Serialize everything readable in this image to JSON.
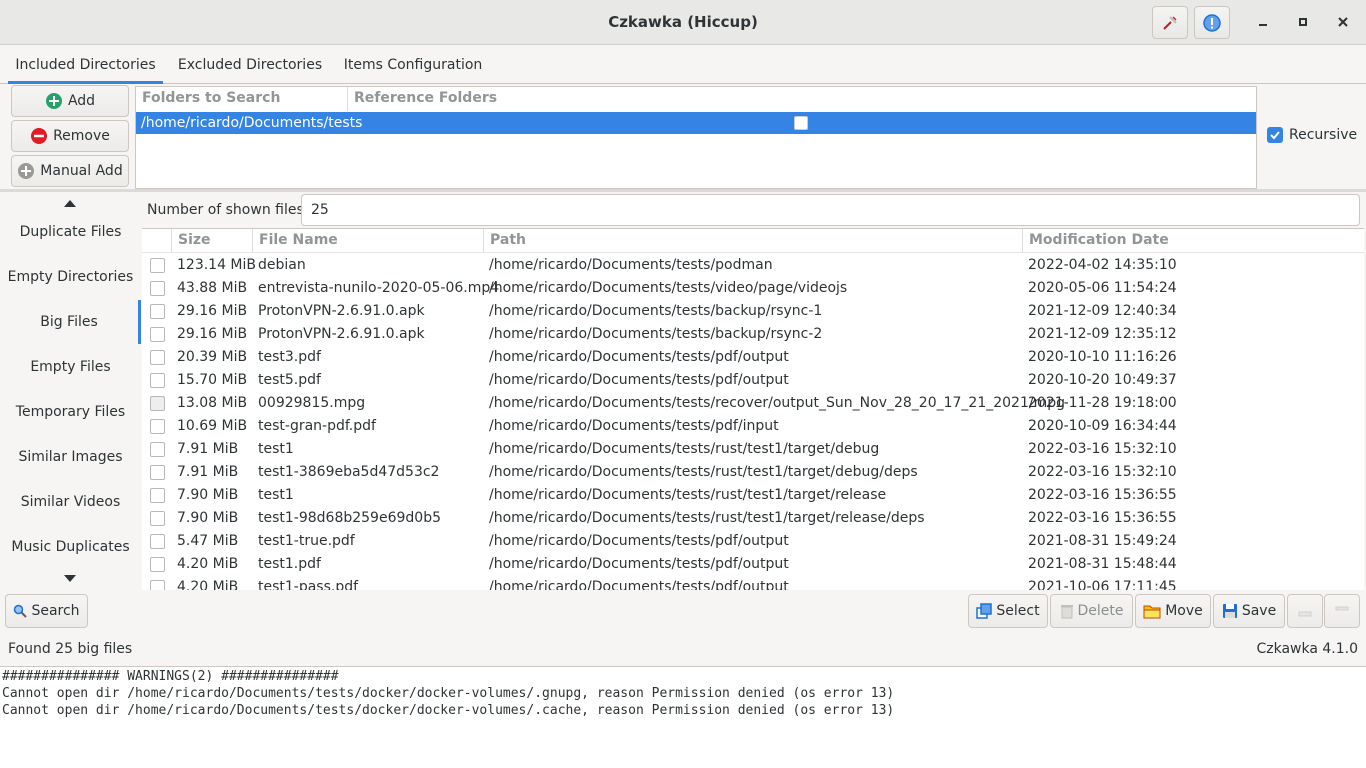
{
  "window": {
    "title": "Czkawka (Hiccup)"
  },
  "tabs": [
    "Included Directories",
    "Excluded Directories",
    "Items Configuration"
  ],
  "dir_buttons": {
    "add": "Add",
    "remove": "Remove",
    "manual_add": "Manual Add"
  },
  "dir_table": {
    "headers": [
      "Folders to Search",
      "Reference Folders"
    ],
    "rows": [
      {
        "path": "/home/ricardo/Documents/tests",
        "reference": false
      }
    ]
  },
  "recursive": {
    "label": "Recursive",
    "checked": true
  },
  "sidebar": {
    "items": [
      "Duplicate Files",
      "Empty Directories",
      "Big Files",
      "Empty Files",
      "Temporary Files",
      "Similar Images",
      "Similar Videos",
      "Music Duplicates"
    ],
    "active": "Big Files"
  },
  "shown_files": {
    "label": "Number of shown files",
    "value": "25"
  },
  "results": {
    "headers": [
      "Size",
      "File Name",
      "Path",
      "Modification Date"
    ],
    "rows": [
      {
        "size": "123.14 MiB",
        "name": "debian",
        "path": "/home/ricardo/Documents/tests/podman",
        "date": "2022-04-02 14:35:10"
      },
      {
        "size": "43.88 MiB",
        "name": "entrevista-nunilo-2020-05-06.mp4",
        "path": "/home/ricardo/Documents/tests/video/page/videojs",
        "date": "2020-05-06 11:54:24"
      },
      {
        "size": "29.16 MiB",
        "name": "ProtonVPN-2.6.91.0.apk",
        "path": "/home/ricardo/Documents/tests/backup/rsync-1",
        "date": "2021-12-09 12:40:34"
      },
      {
        "size": "29.16 MiB",
        "name": "ProtonVPN-2.6.91.0.apk",
        "path": "/home/ricardo/Documents/tests/backup/rsync-2",
        "date": "2021-12-09 12:35:12"
      },
      {
        "size": "20.39 MiB",
        "name": "test3.pdf",
        "path": "/home/ricardo/Documents/tests/pdf/output",
        "date": "2020-10-10 11:16:26"
      },
      {
        "size": "15.70 MiB",
        "name": "test5.pdf",
        "path": "/home/ricardo/Documents/tests/pdf/output",
        "date": "2020-10-20 10:49:37"
      },
      {
        "size": "13.08 MiB",
        "name": "00929815.mpg",
        "path": "/home/ricardo/Documents/tests/recover/output_Sun_Nov_28_20_17_21_2021/mpg",
        "date": "2021-11-28 19:18:00"
      },
      {
        "size": "10.69 MiB",
        "name": "test-gran-pdf.pdf",
        "path": "/home/ricardo/Documents/tests/pdf/input",
        "date": "2020-10-09 16:34:44"
      },
      {
        "size": "7.91 MiB",
        "name": "test1",
        "path": "/home/ricardo/Documents/tests/rust/test1/target/debug",
        "date": "2022-03-16 15:32:10"
      },
      {
        "size": "7.91 MiB",
        "name": "test1-3869eba5d47d53c2",
        "path": "/home/ricardo/Documents/tests/rust/test1/target/debug/deps",
        "date": "2022-03-16 15:32:10"
      },
      {
        "size": "7.90 MiB",
        "name": "test1",
        "path": "/home/ricardo/Documents/tests/rust/test1/target/release",
        "date": "2022-03-16 15:36:55"
      },
      {
        "size": "7.90 MiB",
        "name": "test1-98d68b259e69d0b5",
        "path": "/home/ricardo/Documents/tests/rust/test1/target/release/deps",
        "date": "2022-03-16 15:36:55"
      },
      {
        "size": "5.47 MiB",
        "name": "test1-true.pdf",
        "path": "/home/ricardo/Documents/tests/pdf/output",
        "date": "2021-08-31 15:49:24"
      },
      {
        "size": "4.20 MiB",
        "name": "test1.pdf",
        "path": "/home/ricardo/Documents/tests/pdf/output",
        "date": "2021-08-31 15:48:44"
      },
      {
        "size": "4.20 MiB",
        "name": "test1-pass.pdf",
        "path": "/home/ricardo/Documents/tests/pdf/output",
        "date": "2021-10-06 17:11:45"
      }
    ]
  },
  "toolbar": {
    "search": "Search",
    "select": "Select",
    "delete": "Delete",
    "move": "Move",
    "save": "Save"
  },
  "status": {
    "text": "Found 25 big files",
    "version": "Czkawka 4.1.0"
  },
  "log": {
    "lines": [
      "############### WARNINGS(2) ###############",
      "Cannot open dir /home/ricardo/Documents/tests/docker/docker-volumes/.gnupg, reason Permission denied (os error 13)",
      "Cannot open dir /home/ricardo/Documents/tests/docker/docker-volumes/.cache, reason Permission denied (os error 13)"
    ]
  },
  "colors": {
    "accent": "#3584e4",
    "add_green": "#26a269",
    "remove_red": "#e01b24"
  }
}
